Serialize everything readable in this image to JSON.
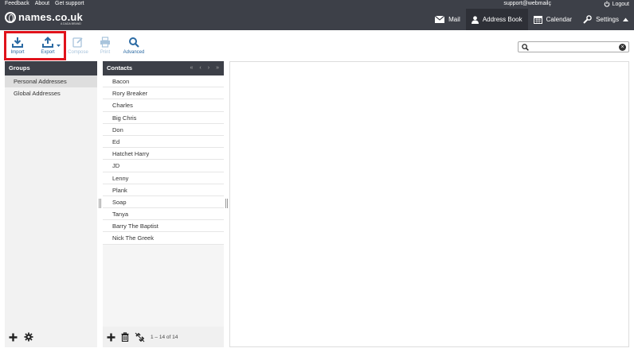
{
  "topbar": {
    "links": [
      "Feedback",
      "About",
      "Get support"
    ],
    "user": "support@webmailç",
    "logout_label": "Logout"
  },
  "header": {
    "logo_text": "names.co.uk",
    "logo_sub": "A DADA BRAND",
    "nav": [
      {
        "label": "Mail",
        "icon": "envelope-icon"
      },
      {
        "label": "Address Book",
        "icon": "person-icon"
      },
      {
        "label": "Calendar",
        "icon": "calendar-icon"
      },
      {
        "label": "Settings",
        "icon": "wrench-icon"
      }
    ]
  },
  "toolbar": {
    "import": "Import",
    "export": "Export",
    "compose": "Compose",
    "print": "Print",
    "advanced": "Advanced",
    "search_value": "",
    "search_placeholder": ""
  },
  "groups": {
    "title": "Groups",
    "items": [
      "Personal Addresses",
      "Global Addresses"
    ],
    "selected_index": 0
  },
  "contacts": {
    "title": "Contacts",
    "items": [
      "Bacon",
      "Rory Breaker",
      "Charles",
      "Big Chris",
      "Don",
      "Ed",
      "Hatchet Harry",
      "JD",
      "Lenny",
      "Plank",
      "Soap",
      "Tanya",
      "Barry The Baptist",
      "Nick The Greek"
    ],
    "count_label": "1 – 14 of 14"
  },
  "colors": {
    "header_bg": "#3d4048",
    "active_nav_bg": "#2e3037",
    "accent": "#2b6aa3",
    "highlight_border": "#e0121b"
  }
}
